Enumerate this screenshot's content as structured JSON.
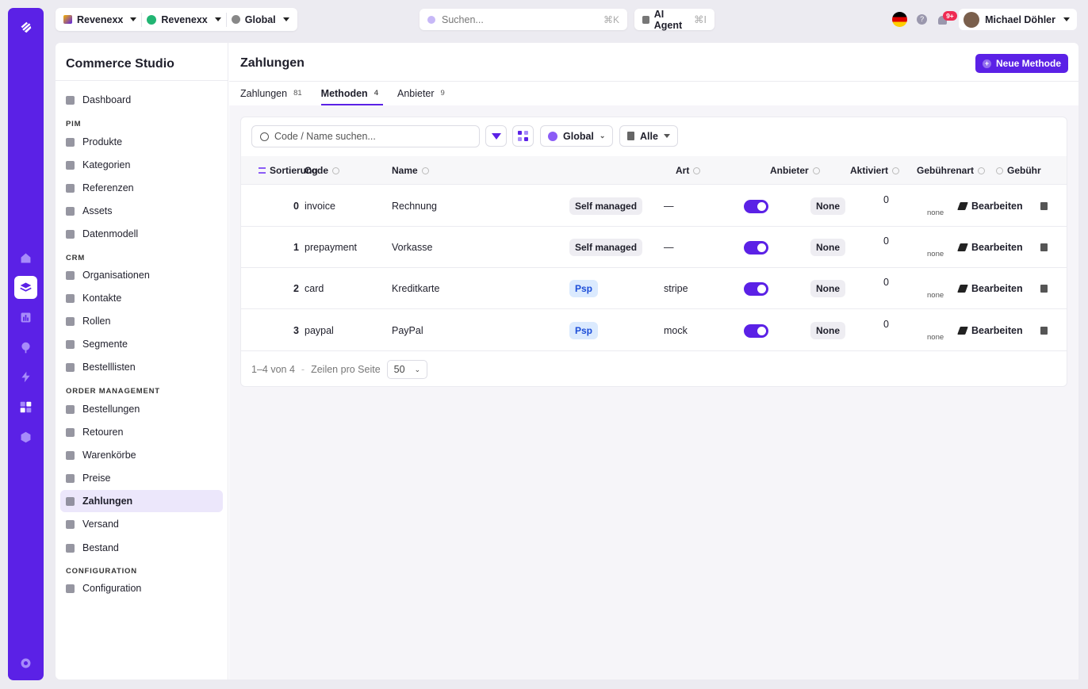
{
  "topbar": {
    "workspace1": "Revenexx",
    "workspace2": "Revenexx",
    "scope": "Global",
    "search_placeholder": "Suchen...",
    "search_shortcut": "⌘K",
    "ai_label": "AI Agent",
    "ai_shortcut": "⌘I",
    "notif_badge": "9+",
    "user_name": "Michael Döhler"
  },
  "sidebar": {
    "title": "Commerce Studio",
    "items": {
      "dashboard": "Dashboard",
      "pim": "PIM",
      "produkte": "Produkte",
      "kategorien": "Kategorien",
      "referenzen": "Referenzen",
      "assets": "Assets",
      "datenmodell": "Datenmodell",
      "crm": "CRM",
      "organisationen": "Organisationen",
      "kontakte": "Kontakte",
      "rollen": "Rollen",
      "segmente": "Segmente",
      "bestelllisten": "Bestelllisten",
      "order": "ORDER MANAGEMENT",
      "bestellungen": "Bestellungen",
      "retouren": "Retouren",
      "warenkoerbe": "Warenkörbe",
      "preise": "Preise",
      "zahlungen": "Zahlungen",
      "versand": "Versand",
      "bestand": "Bestand",
      "config_section": "CONFIGURATION",
      "configuration": "Configuration"
    }
  },
  "page": {
    "title": "Zahlungen",
    "new_button": "Neue Methode",
    "tabs": [
      {
        "label": "Zahlungen",
        "count": "81"
      },
      {
        "label": "Methoden",
        "count": "4"
      },
      {
        "label": "Anbieter",
        "count": "9"
      }
    ]
  },
  "table": {
    "search_placeholder": "Code / Name suchen...",
    "scope_filter": "Global",
    "status_filter": "Alle",
    "headers": {
      "sort": "Sortierung",
      "code": "Code",
      "name": "Name",
      "art": "Art",
      "anbieter": "Anbieter",
      "aktiviert": "Aktiviert",
      "gebuehrenart": "Gebührenart",
      "gebuehr": "Gebühr"
    },
    "rows": [
      {
        "sort": "0",
        "code": "invoice",
        "name": "Rechnung",
        "type": "Self managed",
        "provider": "—",
        "fee_type": "None",
        "fee": "0",
        "fee_unit": "none",
        "edit": "Bearbeiten"
      },
      {
        "sort": "1",
        "code": "prepayment",
        "name": "Vorkasse",
        "type": "Self managed",
        "provider": "—",
        "fee_type": "None",
        "fee": "0",
        "fee_unit": "none",
        "edit": "Bearbeiten"
      },
      {
        "sort": "2",
        "code": "card",
        "name": "Kreditkarte",
        "type": "Psp",
        "provider": "stripe",
        "fee_type": "None",
        "fee": "0",
        "fee_unit": "none",
        "edit": "Bearbeiten"
      },
      {
        "sort": "3",
        "code": "paypal",
        "name": "PayPal",
        "type": "Psp",
        "provider": "mock",
        "fee_type": "None",
        "fee": "0",
        "fee_unit": "none",
        "edit": "Bearbeiten"
      }
    ],
    "pagination": {
      "range": "1–4 von 4",
      "dash": "-",
      "per_page_label": "Zeilen pro Seite",
      "per_page": "50"
    }
  },
  "colors": {
    "accent": "#5b21e6",
    "psp_chip": "#dbeafe"
  }
}
